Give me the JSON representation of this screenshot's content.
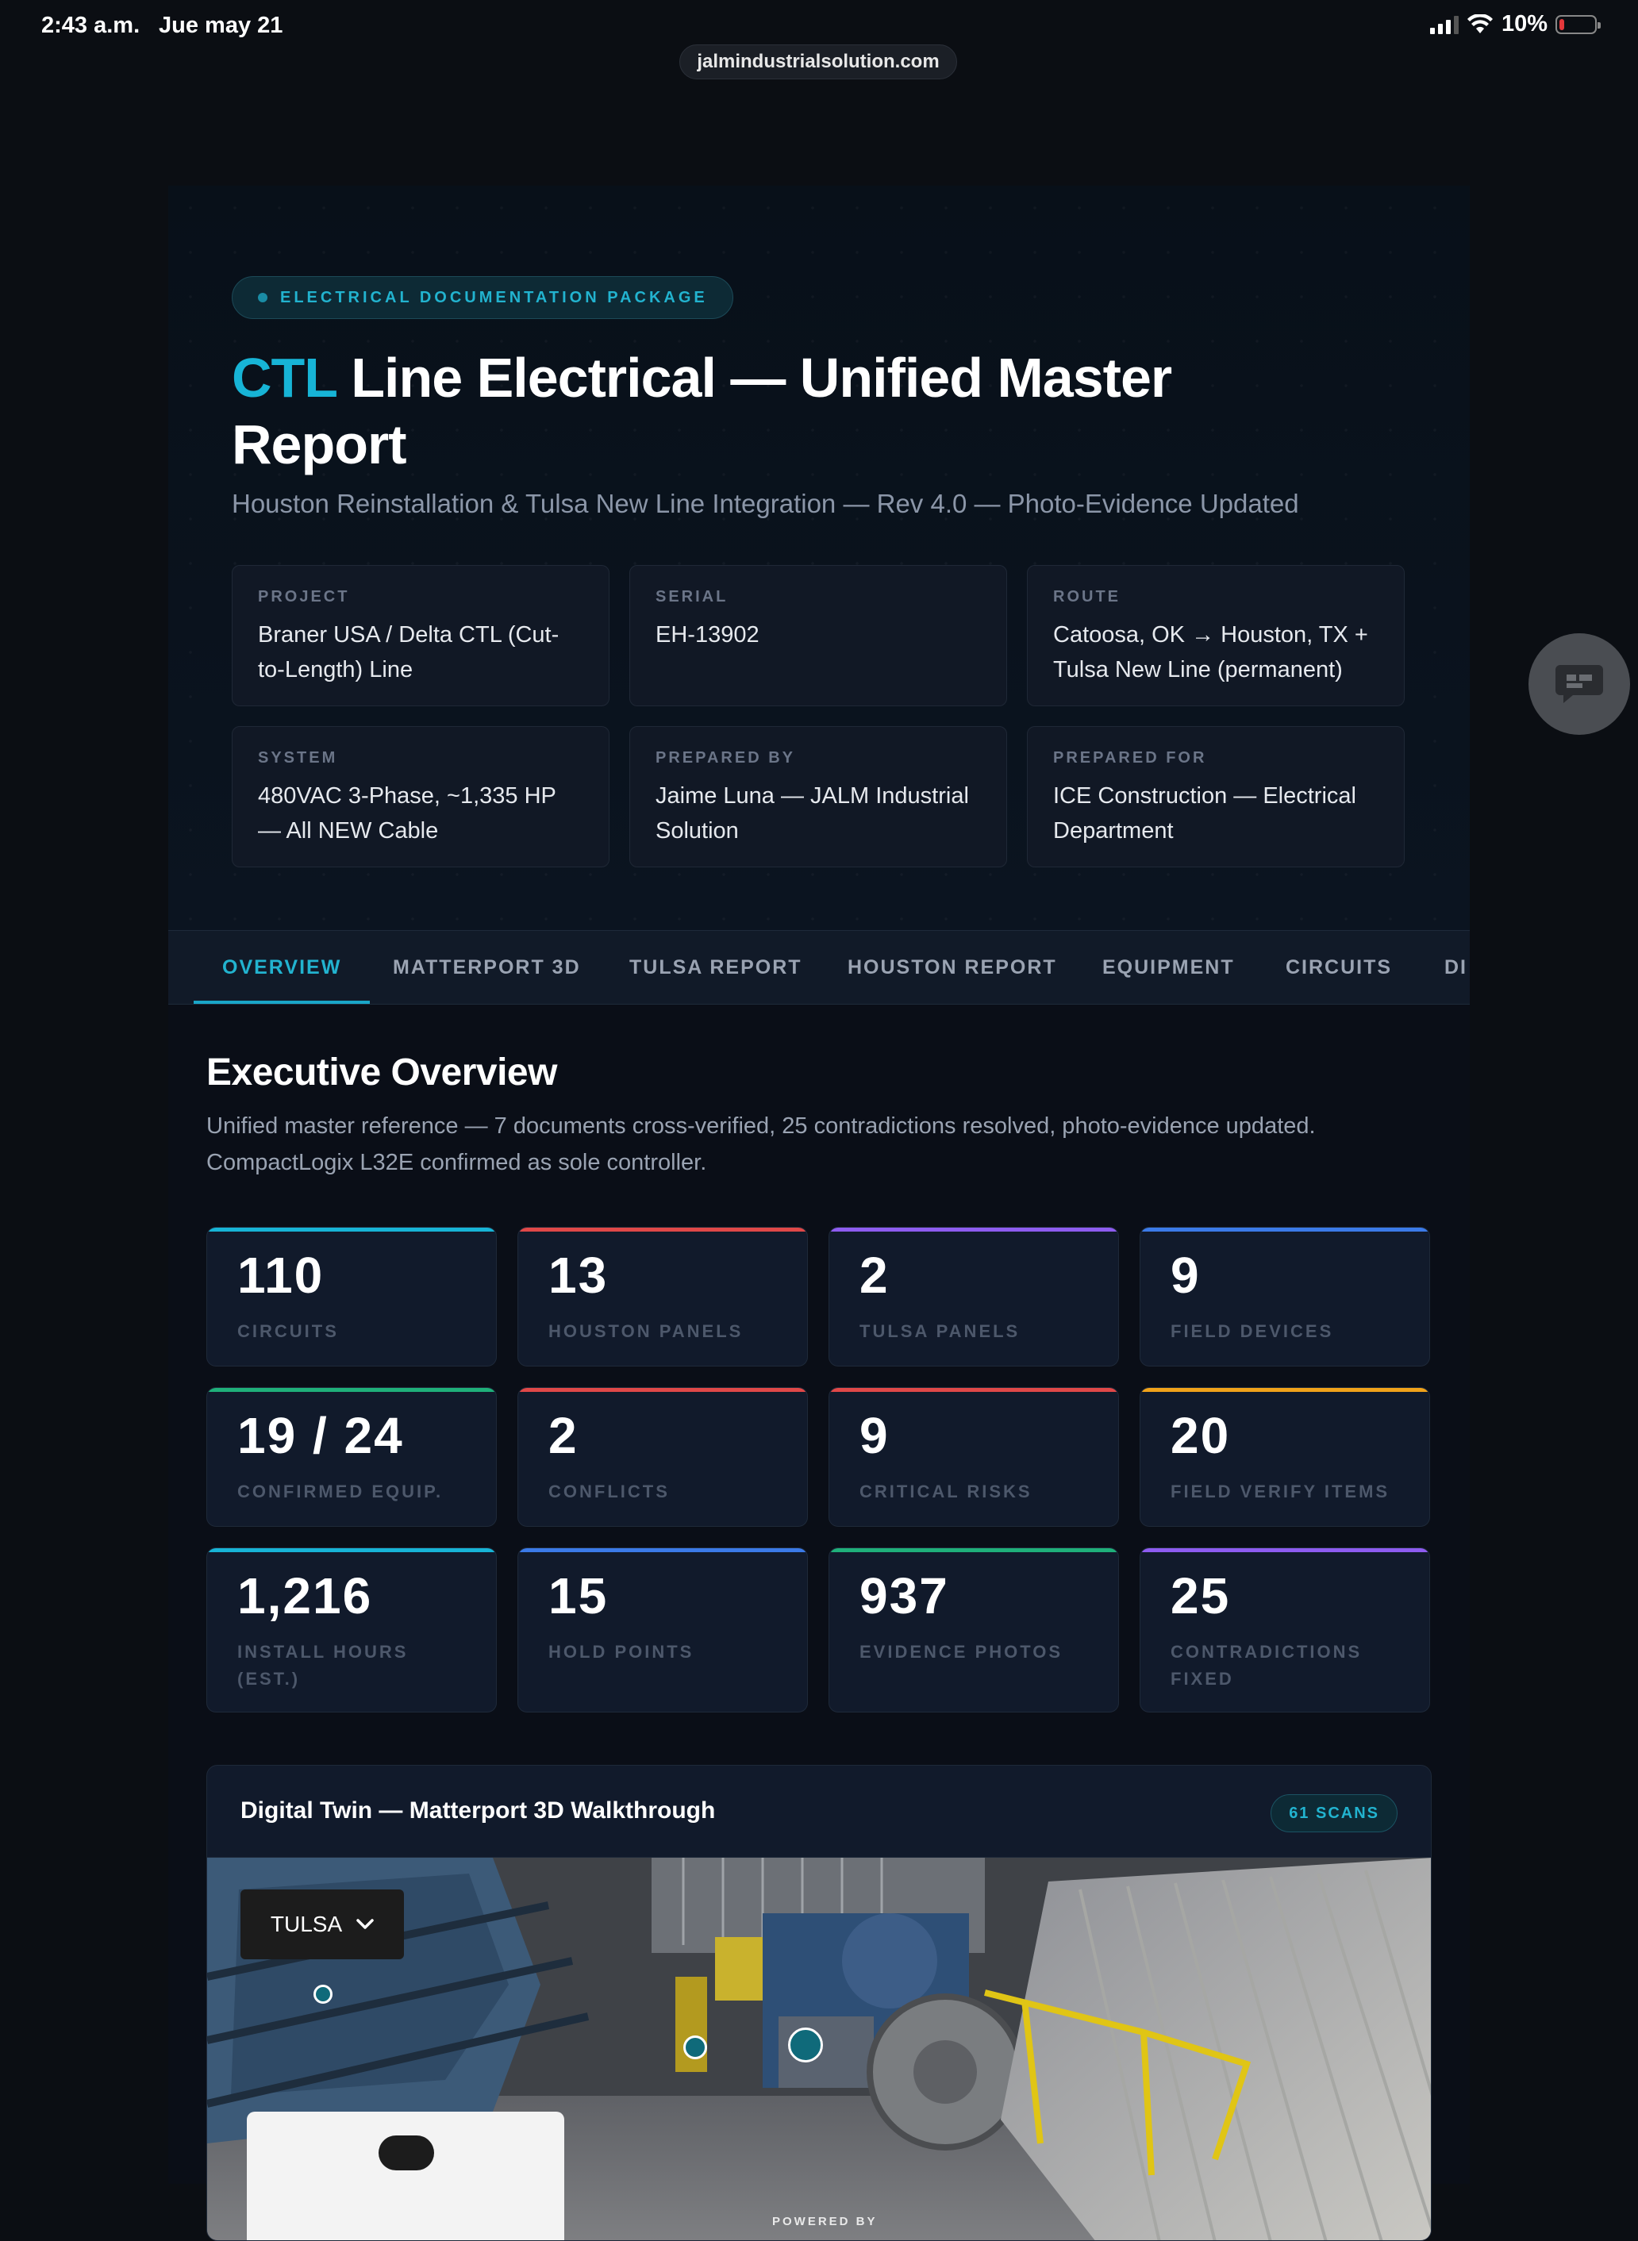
{
  "status_bar": {
    "time": "2:43 a.m.",
    "date": "Jue may 21",
    "battery": "10%"
  },
  "browser": {
    "url": "jalmindustrialsolution.com"
  },
  "hero": {
    "badge": "ELECTRICAL DOCUMENTATION PACKAGE",
    "title_accent": "CTL",
    "title_rest": " Line Electrical — Unified Master Report",
    "subtitle": "Houston Reinstallation & Tulsa New Line Integration — Rev 4.0 — Photo-Evidence Updated",
    "meta": [
      {
        "label": "PROJECT",
        "value": "Braner USA / Delta CTL (Cut-to-Length) Line"
      },
      {
        "label": "SERIAL",
        "value": "EH-13902"
      },
      {
        "label": "ROUTE",
        "value": "Catoosa, OK → Houston, TX + Tulsa New Line (permanent)"
      },
      {
        "label": "SYSTEM",
        "value": "480VAC 3-Phase, ~1,335 HP — All NEW Cable"
      },
      {
        "label": "PREPARED BY",
        "value": "Jaime Luna — JALM Industrial Solution"
      },
      {
        "label": "PREPARED FOR",
        "value": "ICE Construction — Electrical Department"
      }
    ]
  },
  "tabs": [
    {
      "label": "OVERVIEW",
      "active": true
    },
    {
      "label": "MATTERPORT 3D"
    },
    {
      "label": "TULSA REPORT"
    },
    {
      "label": "HOUSTON REPORT"
    },
    {
      "label": "EQUIPMENT"
    },
    {
      "label": "CIRCUITS"
    },
    {
      "label": "DI"
    }
  ],
  "overview": {
    "title": "Executive Overview",
    "description": "Unified master reference — 7 documents cross-verified, 25 contradictions resolved, photo-evidence updated. CompactLogix L32E confirmed as sole controller.",
    "stats": [
      {
        "value": "110",
        "label": "CIRCUITS",
        "color": "#17b4d6"
      },
      {
        "value": "13",
        "label": "HOUSTON PANELS",
        "color": "#e04848"
      },
      {
        "value": "2",
        "label": "TULSA PANELS",
        "color": "#8e5cf0"
      },
      {
        "value": "9",
        "label": "FIELD DEVICES",
        "color": "#3b7ae8"
      },
      {
        "value": "19 / 24",
        "label": "CONFIRMED EQUIP.",
        "color": "#1fb07a"
      },
      {
        "value": "2",
        "label": "CONFLICTS",
        "color": "#e04848"
      },
      {
        "value": "9",
        "label": "CRITICAL RISKS",
        "color": "#e04848"
      },
      {
        "value": "20",
        "label": "FIELD VERIFY ITEMS",
        "color": "#f0a21a"
      },
      {
        "value": "1,216",
        "label": "INSTALL HOURS (EST.)",
        "color": "#17b4d6"
      },
      {
        "value": "15",
        "label": "HOLD POINTS",
        "color": "#3b7ae8"
      },
      {
        "value": "937",
        "label": "EVIDENCE PHOTOS",
        "color": "#1fb07a"
      },
      {
        "value": "25",
        "label": "CONTRADICTIONS FIXED",
        "color": "#8e5cf0"
      }
    ]
  },
  "digital_twin": {
    "title": "Digital Twin — Matterport 3D Walkthrough",
    "scans_badge": "61 SCANS",
    "location_select": "TULSA",
    "powered_by": "POWERED BY"
  }
}
